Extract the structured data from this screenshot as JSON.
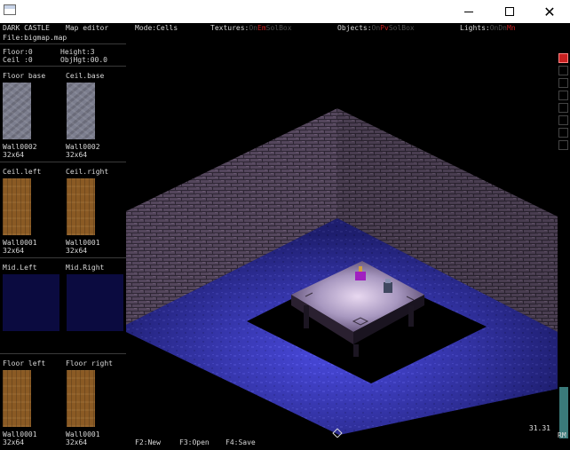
{
  "app": {
    "name": "DARK CASTLE",
    "title": "Map editor",
    "file": "File:bigmap.map"
  },
  "window": {
    "minimize_glyph": "—",
    "close_glyph": "✕"
  },
  "status": {
    "mode": "Mode:Cells",
    "textures_label": "Textures:",
    "textures_opts": [
      "On",
      "Em",
      "SolBox"
    ],
    "objects_label": "Objects:",
    "objects_opts": [
      "On",
      "Pv",
      "SolBox"
    ],
    "lights_label": "Lights:",
    "lights_opts": [
      "On",
      "Dn",
      "Mn"
    ]
  },
  "cell": {
    "floor": "Floor:0",
    "ceil": "Ceil :0",
    "height": "Height:3",
    "objhgt": "ObjHgt:00.0"
  },
  "slots": [
    {
      "left_title": "Floor base",
      "right_title": "Ceil.base",
      "left_name": "Wall0002",
      "left_size": "32x64",
      "right_name": "Wall0002",
      "right_size": "32x64"
    },
    {
      "left_title": "Ceil.left",
      "right_title": "Ceil.right",
      "left_name": "Wall0001",
      "left_size": "32x64",
      "right_name": "Wall0001",
      "right_size": "32x64"
    },
    {
      "left_title": "Mid.Left",
      "right_title": "Mid.Right",
      "left_name": "",
      "left_size": "",
      "right_name": "",
      "right_size": ""
    },
    {
      "left_title": "Floor left",
      "right_title": "Floor right",
      "left_name": "Wall0001",
      "left_size": "32x64",
      "right_name": "Wall0001",
      "right_size": "32x64"
    }
  ],
  "viewport": {
    "fps": "31.31"
  },
  "toolstrip": {
    "label": "RM"
  },
  "bottombar": {
    "f2": "F2:New",
    "f3": "F3:Open",
    "f4": "F4:Save"
  },
  "colors": {
    "accent_red": "#c82020",
    "floor_blue": "#3a3ad8",
    "wall_brick": "#5a4a60",
    "table_top": "#b0a0c8"
  }
}
